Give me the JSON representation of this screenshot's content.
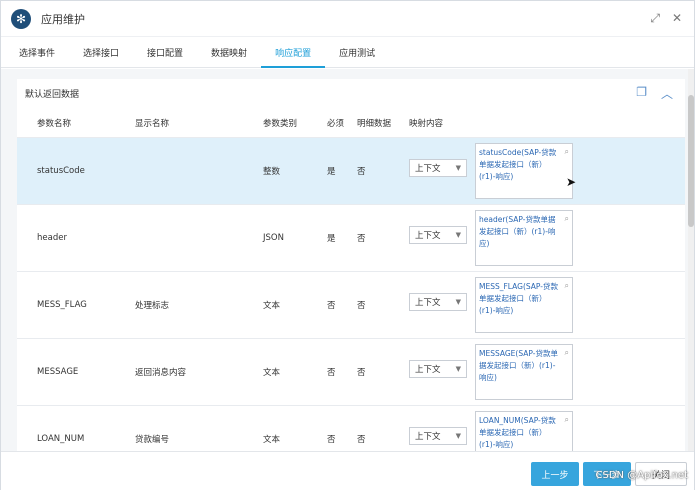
{
  "window": {
    "title": "应用维护",
    "app_icon": "gear-icon",
    "accent": "#1e9fd8"
  },
  "tabs": [
    {
      "label": "选择事件",
      "active": false
    },
    {
      "label": "选择接口",
      "active": false
    },
    {
      "label": "接口配置",
      "active": false
    },
    {
      "label": "数据映射",
      "active": false
    },
    {
      "label": "响应配置",
      "active": true
    },
    {
      "label": "应用测试",
      "active": false
    }
  ],
  "section": {
    "title": "默认返回数据"
  },
  "table": {
    "headers": [
      "参数名称",
      "显示名称",
      "参数类别",
      "必须",
      "明细数据",
      "映射内容"
    ],
    "rows": [
      {
        "name": "statusCode",
        "display": "",
        "type": "整数",
        "required": "是",
        "detail": "否",
        "map": "上下文",
        "ref": "statusCode(SAP-贷款单据发起接口（新）(r1)-响应)",
        "selected": true
      },
      {
        "name": "header",
        "display": "",
        "type": "JSON",
        "required": "是",
        "detail": "否",
        "map": "上下文",
        "ref": "header(SAP-贷款单据发起接口（新）(r1)-响应)",
        "selected": false
      },
      {
        "name": "MESS_FLAG",
        "display": "处理标志",
        "type": "文本",
        "required": "否",
        "detail": "否",
        "map": "上下文",
        "ref": "MESS_FLAG(SAP-贷款单据发起接口（新）(r1)-响应)",
        "selected": false
      },
      {
        "name": "MESSAGE",
        "display": "返回消息内容",
        "type": "文本",
        "required": "否",
        "detail": "否",
        "map": "上下文",
        "ref": "MESSAGE(SAP-贷款单据发起接口（新）(r1)-响应)",
        "selected": false
      },
      {
        "name": "LOAN_NUM",
        "display": "贷款编号",
        "type": "文本",
        "required": "否",
        "detail": "否",
        "map": "上下文",
        "ref": "LOAN_NUM(SAP-贷款单据发起接口（新）(r1)-响应)",
        "selected": false
      }
    ]
  },
  "footer": {
    "prev_label": "上一步",
    "next_label": "下一步",
    "close_label": "关闭",
    "watermark": "CSDN @Apifox.net"
  }
}
